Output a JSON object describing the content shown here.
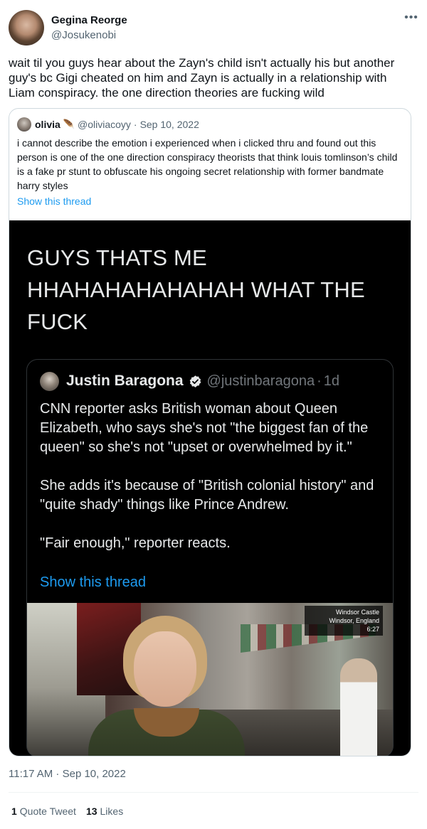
{
  "tweet": {
    "author_name": "Gegina Reorge",
    "author_handle": "@Josukenobi",
    "more_icon": "ellipsis-icon",
    "text": "wait til you guys hear about the Zayn's child isn't actually his but another guy's bc Gigi cheated on him and Zayn is actually in a relationship with Liam conspiracy. the one direction theories are fucking wild",
    "timestamp": "11:17 AM · Sep 10, 2022",
    "stats": {
      "quote_tweets_count": "1",
      "quote_tweets_label": "Quote Tweet",
      "likes_count": "13",
      "likes_label": "Likes"
    }
  },
  "quoted_tweet": {
    "author_name": "olivia",
    "emoji": "🪶",
    "author_handle": "@oliviacoyy",
    "separator": "·",
    "date": "Sep 10, 2022",
    "text": "i cannot describe the emotion i experienced when i clicked thru and found out this person is one of the one direction conspiracy theorists that think louis tomlinson’s child is a fake pr stunt to obfuscate his ongoing secret relationship with former bandmate harry styles",
    "show_thread": "Show this thread",
    "screenshot": {
      "caption": "GUYS THATS ME HHAHAHAHAHAHAH WHAT THE FUCK",
      "inner_tweet": {
        "author_name": "Justin Baragona",
        "verified_icon": "verified-badge-icon",
        "author_handle": "@justinbaragona",
        "separator": "·",
        "time": "1d",
        "paragraphs": [
          "CNN reporter asks British woman about Queen Elizabeth, who says she's not \"the biggest fan of the queen\" so she's not \"upset or overwhelmed by it.\"",
          "She adds it's because of \"British colonial history\" and \"quite shady\" things like Prince Andrew.",
          "\"Fair enough,\" reporter reacts."
        ],
        "show_thread": "Show this thread",
        "video": {
          "location_line1": "Windsor Castle",
          "location_line2": "Windsor, England",
          "time": "6:27"
        }
      }
    }
  },
  "colors": {
    "link_blue": "#1d9bf0",
    "text_primary": "#0f1419",
    "text_secondary": "#536471",
    "border": "#cfd9de",
    "dark_bg": "#000000",
    "dark_text": "#e7e9ea"
  }
}
